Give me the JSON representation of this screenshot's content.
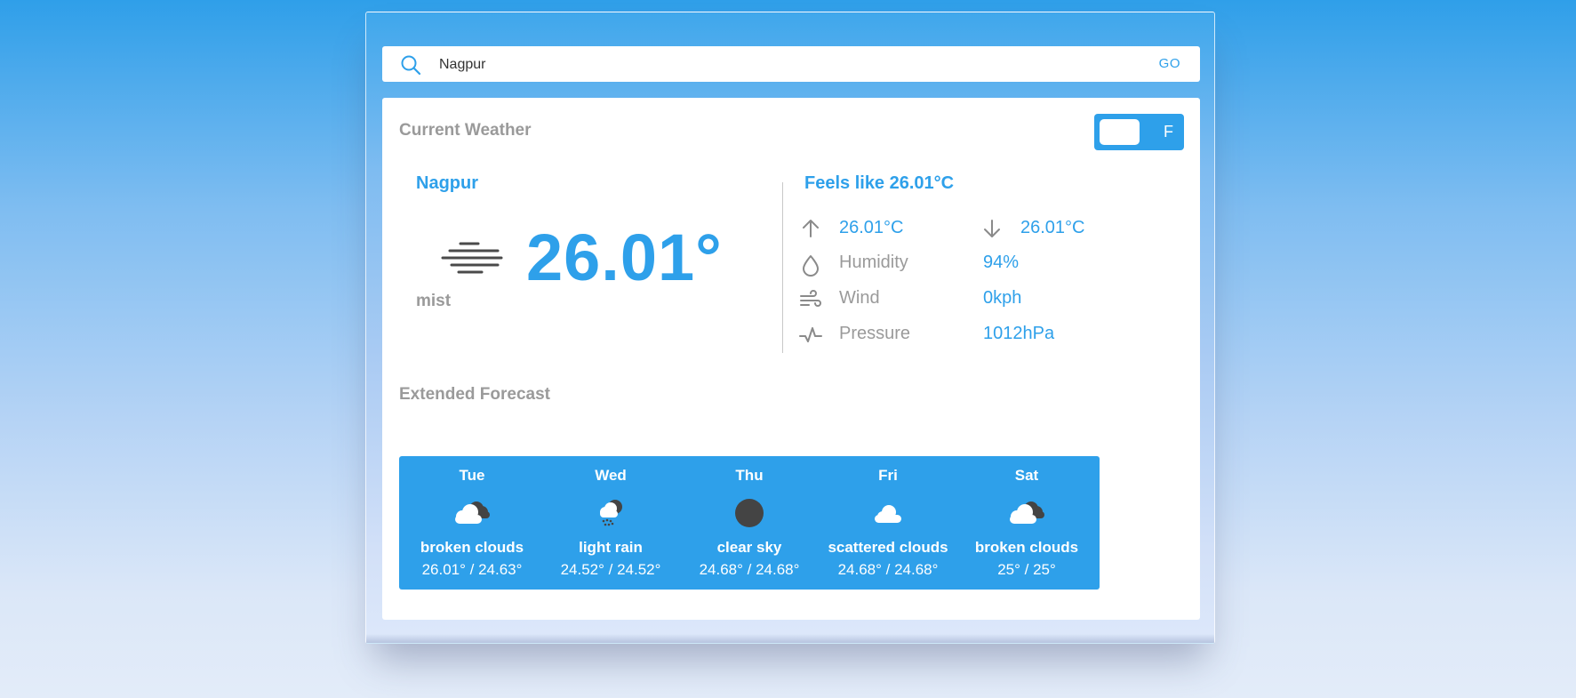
{
  "search": {
    "value": "Nagpur",
    "go_label": "GO"
  },
  "current": {
    "section_title": "Current Weather",
    "unit_toggle_label": "F",
    "city": "Nagpur",
    "icon": "mist-icon",
    "temperature": "26.01°",
    "description": "mist",
    "feels_like": "Feels like 26.01°C",
    "temp_max": "26.01°C",
    "temp_min": "26.01°C",
    "humidity_label": "Humidity",
    "humidity_value": "94%",
    "wind_label": "Wind",
    "wind_value": "0kph",
    "pressure_label": "Pressure",
    "pressure_value": "1012hPa"
  },
  "forecast": {
    "section_title": "Extended Forecast",
    "days": [
      {
        "day": "Tue",
        "icon": "broken-clouds-icon",
        "desc": "broken clouds",
        "range": "26.01° / 24.63°"
      },
      {
        "day": "Wed",
        "icon": "light-rain-icon",
        "desc": "light rain",
        "range": "24.52° / 24.52°"
      },
      {
        "day": "Thu",
        "icon": "clear-sky-icon",
        "desc": "clear sky",
        "range": "24.68° / 24.68°"
      },
      {
        "day": "Fri",
        "icon": "scattered-clouds-icon",
        "desc": "scattered clouds",
        "range": "24.68° / 24.68°"
      },
      {
        "day": "Sat",
        "icon": "broken-clouds-icon",
        "desc": "broken clouds",
        "range": "25° / 25°"
      }
    ]
  },
  "colors": {
    "accent": "#2ea0ea",
    "muted": "#9a9a9a"
  }
}
